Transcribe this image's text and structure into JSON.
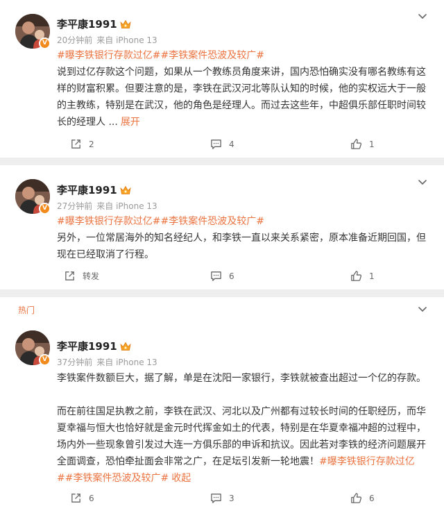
{
  "posts": [
    {
      "user": "李平康1991",
      "time": "20分钟前",
      "source": "来自 iPhone 13",
      "hashtags": "#曝李铁银行存款过亿##李铁案件恐波及较广#",
      "text": "说到过亿存款这个问题，如果从一个教练员角度来讲，国内恐怕确实没有哪名教练有这样的财富积累。但要注意的是，李铁在武汉河北等队认知的时候，他的实权远大于一般的主教练，特别是在武汉，他的角色是经理人。而过去这些年，中超俱乐部任职时间较长的经理人 ...",
      "more": "展开",
      "repost": "2",
      "comment": "4",
      "like": "1"
    },
    {
      "user": "李平康1991",
      "time": "27分钟前",
      "source": "来自 iPhone 13",
      "hashtags": "#曝李铁银行存款过亿##李铁案件恐波及较广#",
      "text": "另外，一位常居海外的知名经纪人，和李铁一直以来关系紧密，原本准备近期回国，但现在已经取消了行程。",
      "repost": "转发",
      "comment": "6",
      "like": "1"
    },
    {
      "label": "热门",
      "user": "李平康1991",
      "time": "37分钟前",
      "source": "来自 iPhone 13",
      "text1": "李铁案件数额巨大，据了解，单是在沈阳一家银行，李铁就被查出超过一个亿的存款。",
      "text2": "而在前往国足执教之前，李铁在武汉、河北以及广州都有过较长时间的任职经历，而华夏幸福与恒大也恰好就是金元时代挥金如土的代表，特别是在华夏幸福冲超的过程中，场内外一些现象曾引发过大连一方俱乐部的申诉和抗议。因此若对李铁的经济问题展开全面调查，恐怕牵扯面会非常之广，在足坛引发新一轮地震！",
      "hashtags": "#曝李铁银行存款过亿##李铁案件恐波及较广#",
      "collapse": "收起",
      "repost": "6",
      "comment": "3",
      "like": "6"
    }
  ],
  "icons": {
    "repost": "share-out-icon",
    "comment": "comment-bubble-icon",
    "like": "thumbs-up-icon",
    "menu": "chevron-down-icon",
    "badge": "crown-badge-icon",
    "verified": "verified-v-icon"
  },
  "colors": {
    "accent": "#eb7340",
    "background": "#eeeeee",
    "card": "#ffffff"
  }
}
